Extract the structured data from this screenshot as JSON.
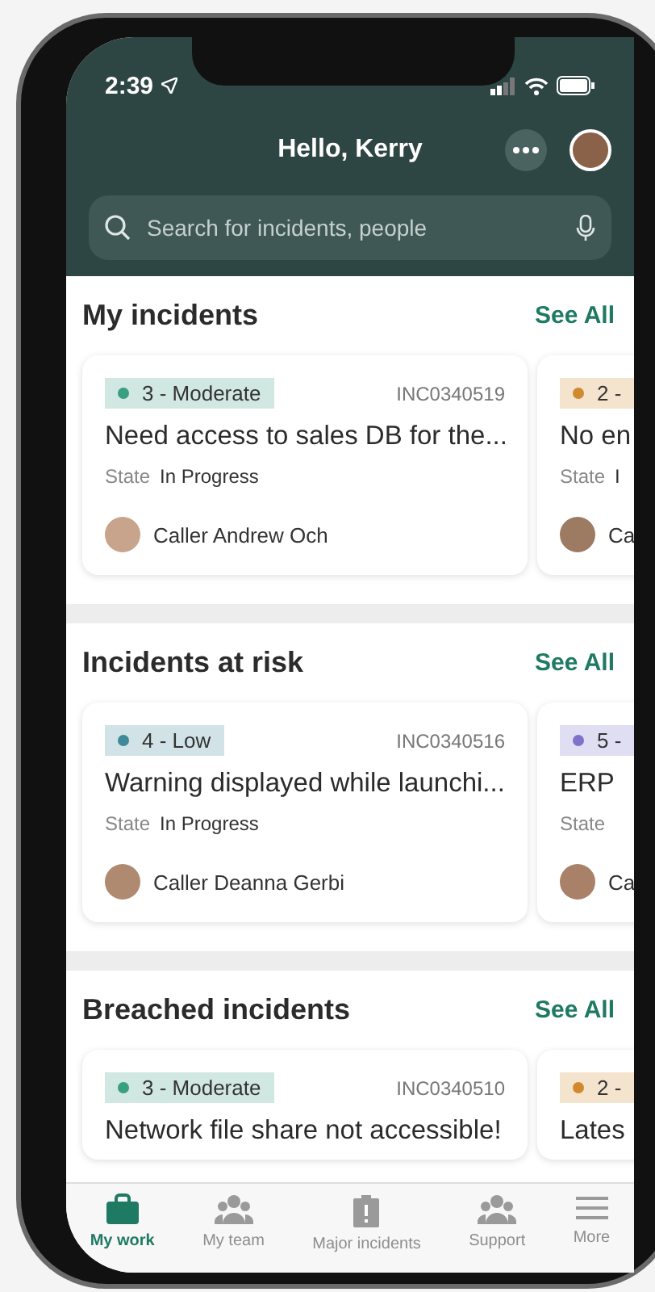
{
  "status_bar": {
    "time": "2:39"
  },
  "header": {
    "title": "Hello, Kerry",
    "search": {
      "placeholder": "Search for incidents, people"
    }
  },
  "sections": [
    {
      "title": "My incidents",
      "action": "See All",
      "cards": [
        {
          "kind": "full",
          "priority": "3 - Moderate",
          "color": "#3a9e80",
          "number": "INC0340519",
          "title": "Need access to sales DB for the...",
          "state_label": "State",
          "state": "In Progress",
          "caller": "Caller Andrew Och"
        },
        {
          "kind": "peek",
          "priority": "2 -",
          "color": "#d08a2d",
          "title": "No en",
          "state_label": "State",
          "state": "I",
          "caller": "Ca"
        }
      ]
    },
    {
      "title": "Incidents at risk",
      "action": "See All",
      "cards": [
        {
          "kind": "full",
          "priority": "4 - Low",
          "color": "#3d8a99",
          "number": "INC0340516",
          "title": "Warning displayed while launchi...",
          "state_label": "State",
          "state": "In Progress",
          "caller": "Caller Deanna Gerbi"
        },
        {
          "kind": "peek",
          "priority": "5 -",
          "color": "#7f73c9",
          "title": "ERP",
          "state_label": "State",
          "caller": "Ca"
        }
      ]
    },
    {
      "title": "Breached incidents",
      "action": "See All",
      "cards": [
        {
          "kind": "full",
          "priority": "3 - Moderate",
          "color": "#3a9e80",
          "number": "INC0340510",
          "title": "Network file share not accessible!"
        },
        {
          "kind": "peek",
          "priority": "2 -",
          "color": "#d08a2d",
          "title": "Lates"
        }
      ]
    }
  ],
  "tabs": [
    {
      "label": "My work",
      "selected": true
    },
    {
      "label": "My team",
      "selected": false
    },
    {
      "label": "Major incidents",
      "selected": false
    },
    {
      "label": "Support",
      "selected": false
    },
    {
      "label": "More",
      "selected": false
    }
  ]
}
